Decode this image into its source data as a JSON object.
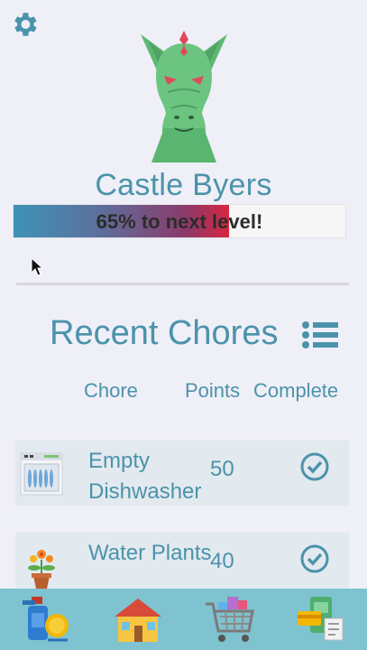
{
  "settings": {
    "icon": "gear-icon"
  },
  "profile": {
    "name": "Castle Byers",
    "progress_percent": 65,
    "progress_label": "65% to next level!",
    "mascot": "dragon-mascot"
  },
  "recent": {
    "title": "Recent Chores",
    "menu_icon": "list-icon",
    "columns": {
      "chore": "Chore",
      "points": "Points",
      "complete": "Complete"
    },
    "items": [
      {
        "name": "Empty Dishwasher",
        "points": "50",
        "icon": "dishwasher-icon",
        "complete": true
      },
      {
        "name": "Water Plants",
        "points": "40",
        "icon": "flower-pot-icon",
        "complete": true
      }
    ]
  },
  "nav": [
    {
      "name": "chores",
      "icon": "spray-bottle-coin-icon"
    },
    {
      "name": "home",
      "icon": "house-icon"
    },
    {
      "name": "shop",
      "icon": "shopping-cart-icon"
    },
    {
      "name": "rewards",
      "icon": "money-cards-icon"
    }
  ],
  "colors": {
    "accent": "#4b93aa",
    "nav_bg": "#7ec3cf",
    "progress_end": "#d8263f"
  }
}
